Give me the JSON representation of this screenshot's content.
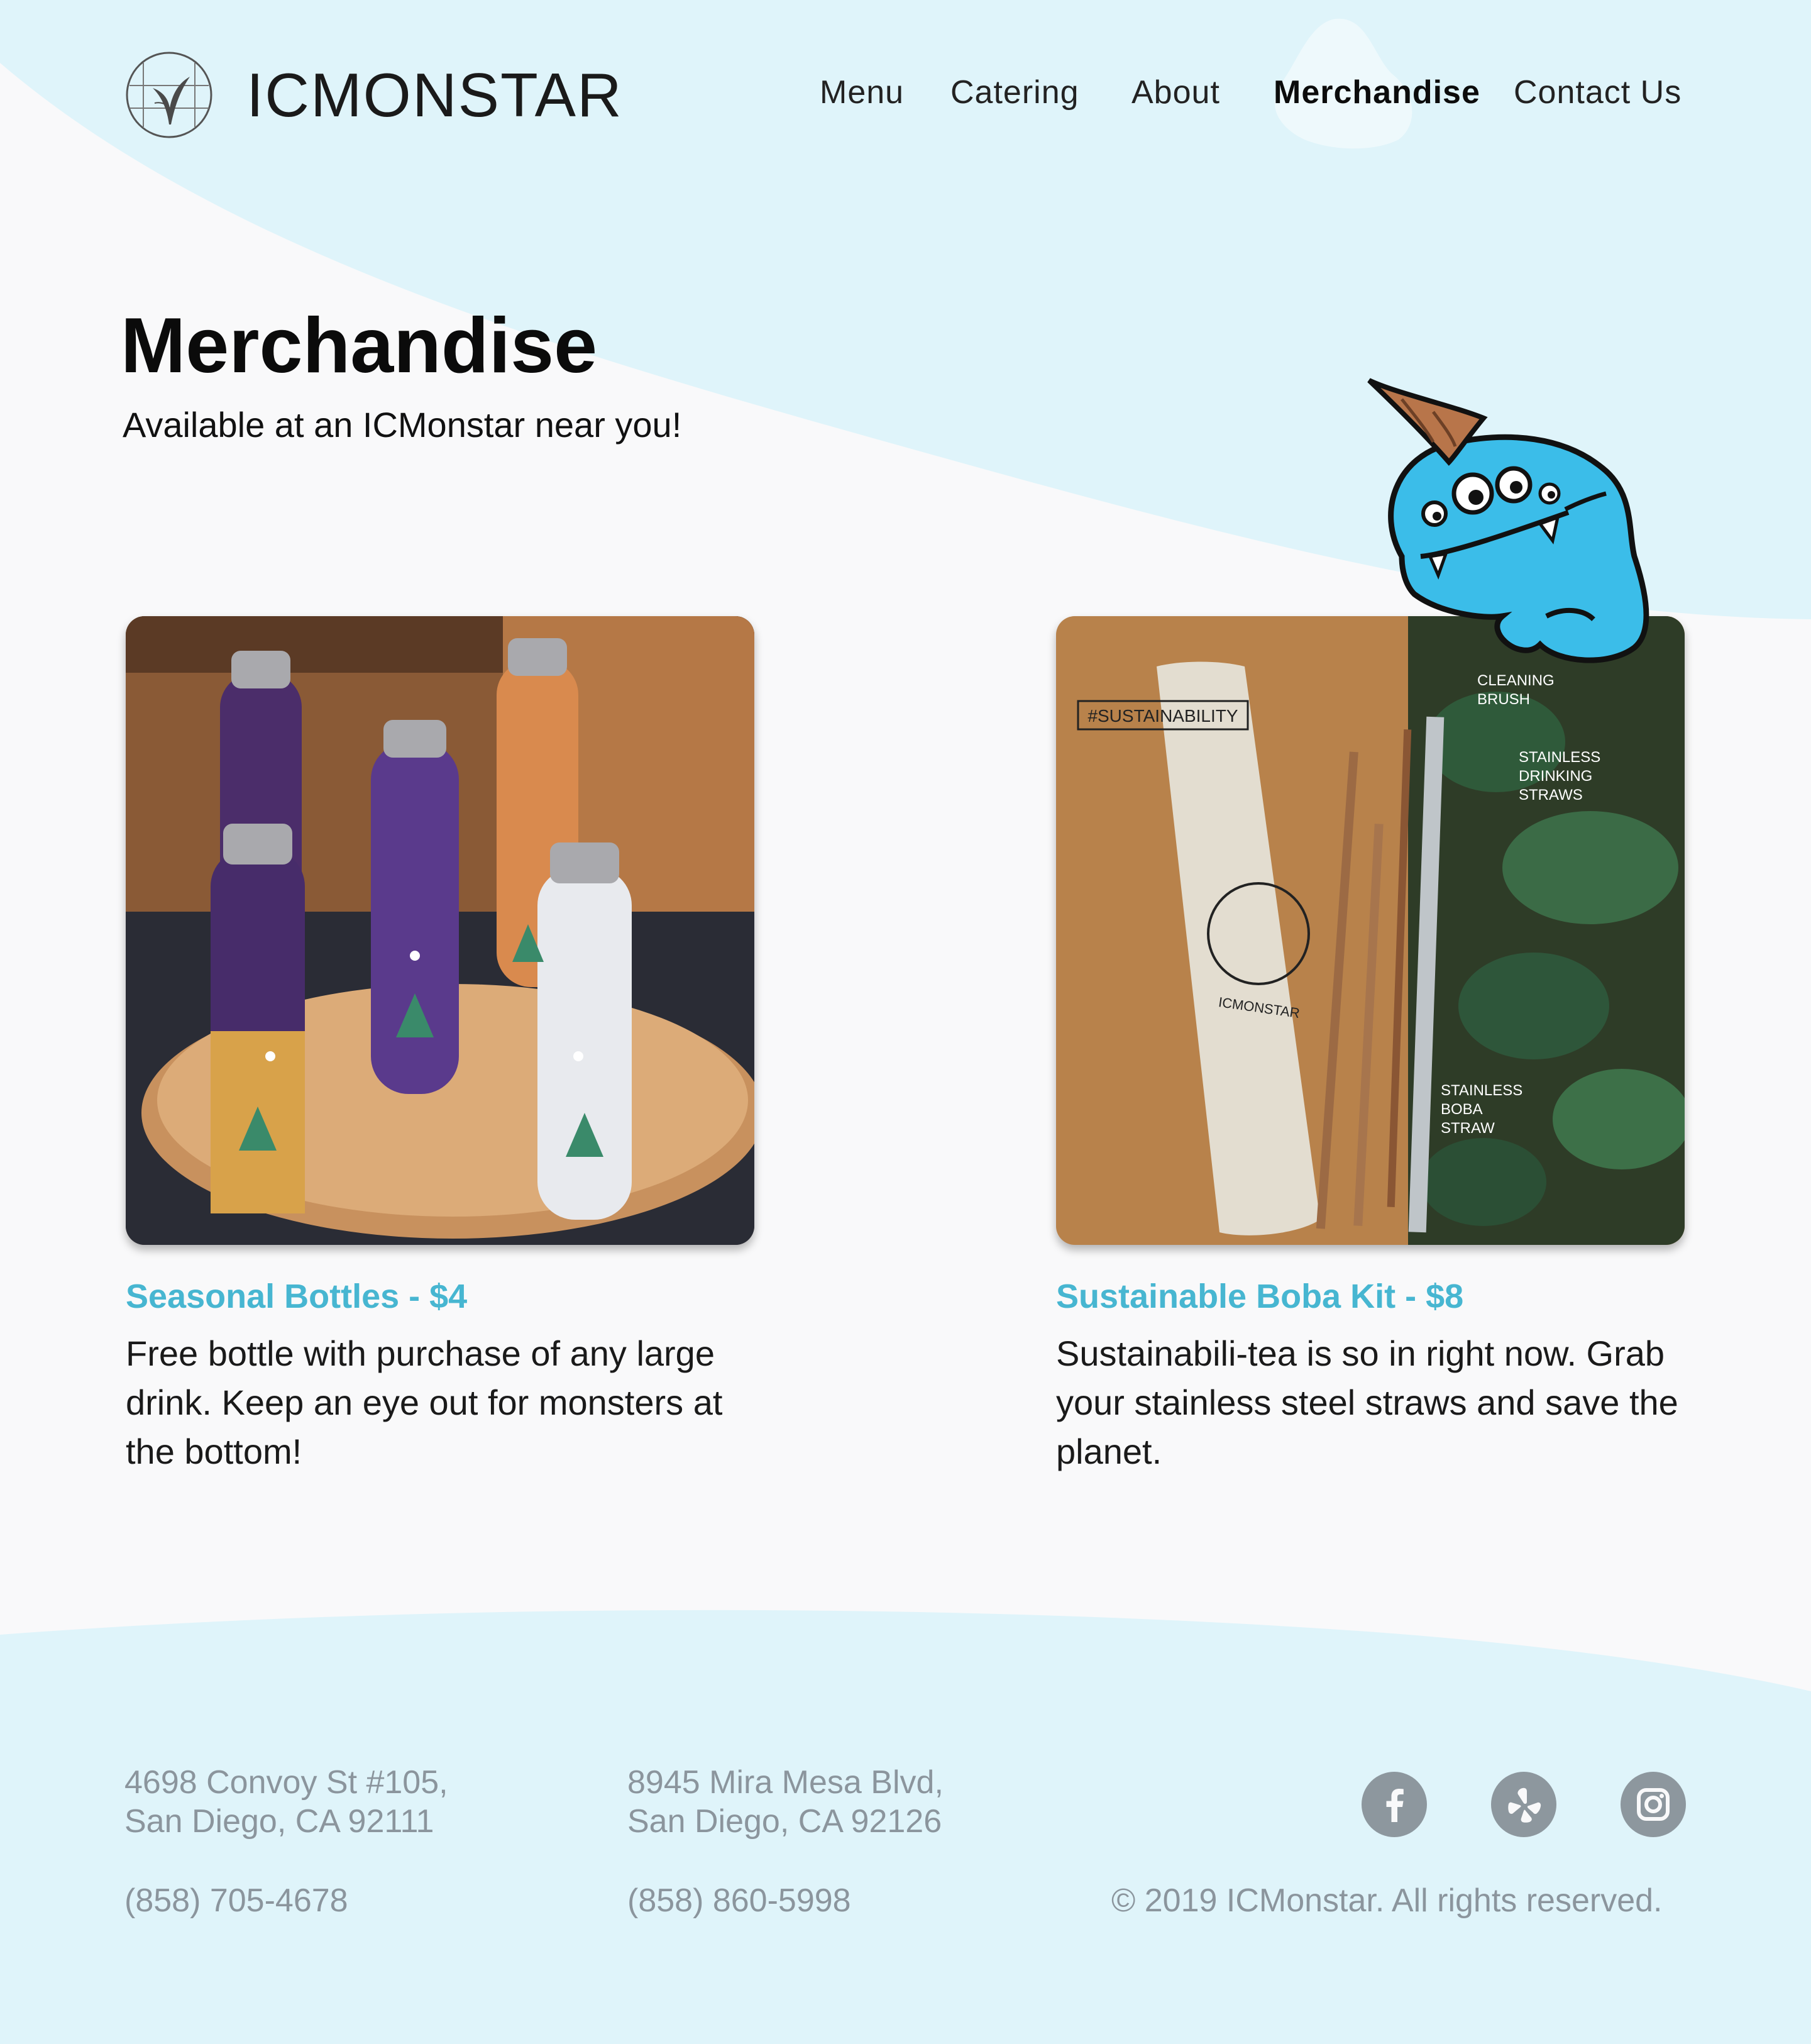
{
  "colors": {
    "page_background": "#f9f9fa",
    "wave_light_blue": "#dff4fa",
    "accent_teal": "#47b6d1",
    "footer_text": "#8b959d",
    "social_icon_bg": "#8d979e",
    "mascot_blue": "#3bbde9"
  },
  "header": {
    "logo_icon": "leaf-crest-logo",
    "brand_name": "ICMONSTAR",
    "nav": [
      {
        "label": "Menu",
        "active": false
      },
      {
        "label": "Catering",
        "active": false
      },
      {
        "label": "About",
        "active": false
      },
      {
        "label": "Merchandise",
        "active": true
      },
      {
        "label": "Contact Us",
        "active": false
      }
    ]
  },
  "hero": {
    "title": "Merchandise",
    "subtitle": "Available at an ICMonstar near you!",
    "mascot_icon": "blue-unicorn-monster"
  },
  "products": [
    {
      "name": "Seasonal Bottles - $4",
      "description": "Free bottle with purchase of any large drink. Keep an eye out for monsters at the bottom!",
      "image_icon": "seasonal-bottles-photo"
    },
    {
      "name": "Sustainable Boba Kit - $8",
      "description": "Sustainabili-tea is so in right now. Grab your stainless steel straws and save the planet.",
      "image_icon": "boba-kit-photo",
      "image_labels": {
        "hashtag": "#SUSTAINABILITY",
        "cleaning_brush": [
          "CLEANING",
          "BRUSH"
        ],
        "drinking_straws": [
          "STAINLESS",
          "DRINKING",
          "STRAWS"
        ],
        "boba_straw": [
          "STAINLESS",
          "BOBA",
          "STRAW"
        ],
        "pouch_brand": "ICMONSTAR"
      }
    }
  ],
  "footer": {
    "locations": [
      {
        "address_line1": "4698 Convoy St #105,",
        "address_line2": "San Diego, CA 92111",
        "phone": "(858) 705-4678"
      },
      {
        "address_line1": "8945 Mira Mesa Blvd,",
        "address_line2": "San Diego, CA 92126",
        "phone": "(858) 860-5998"
      }
    ],
    "social": [
      {
        "icon": "facebook-icon"
      },
      {
        "icon": "yelp-icon"
      },
      {
        "icon": "instagram-icon"
      }
    ],
    "copyright": "© 2019 ICMonstar. All rights reserved."
  }
}
